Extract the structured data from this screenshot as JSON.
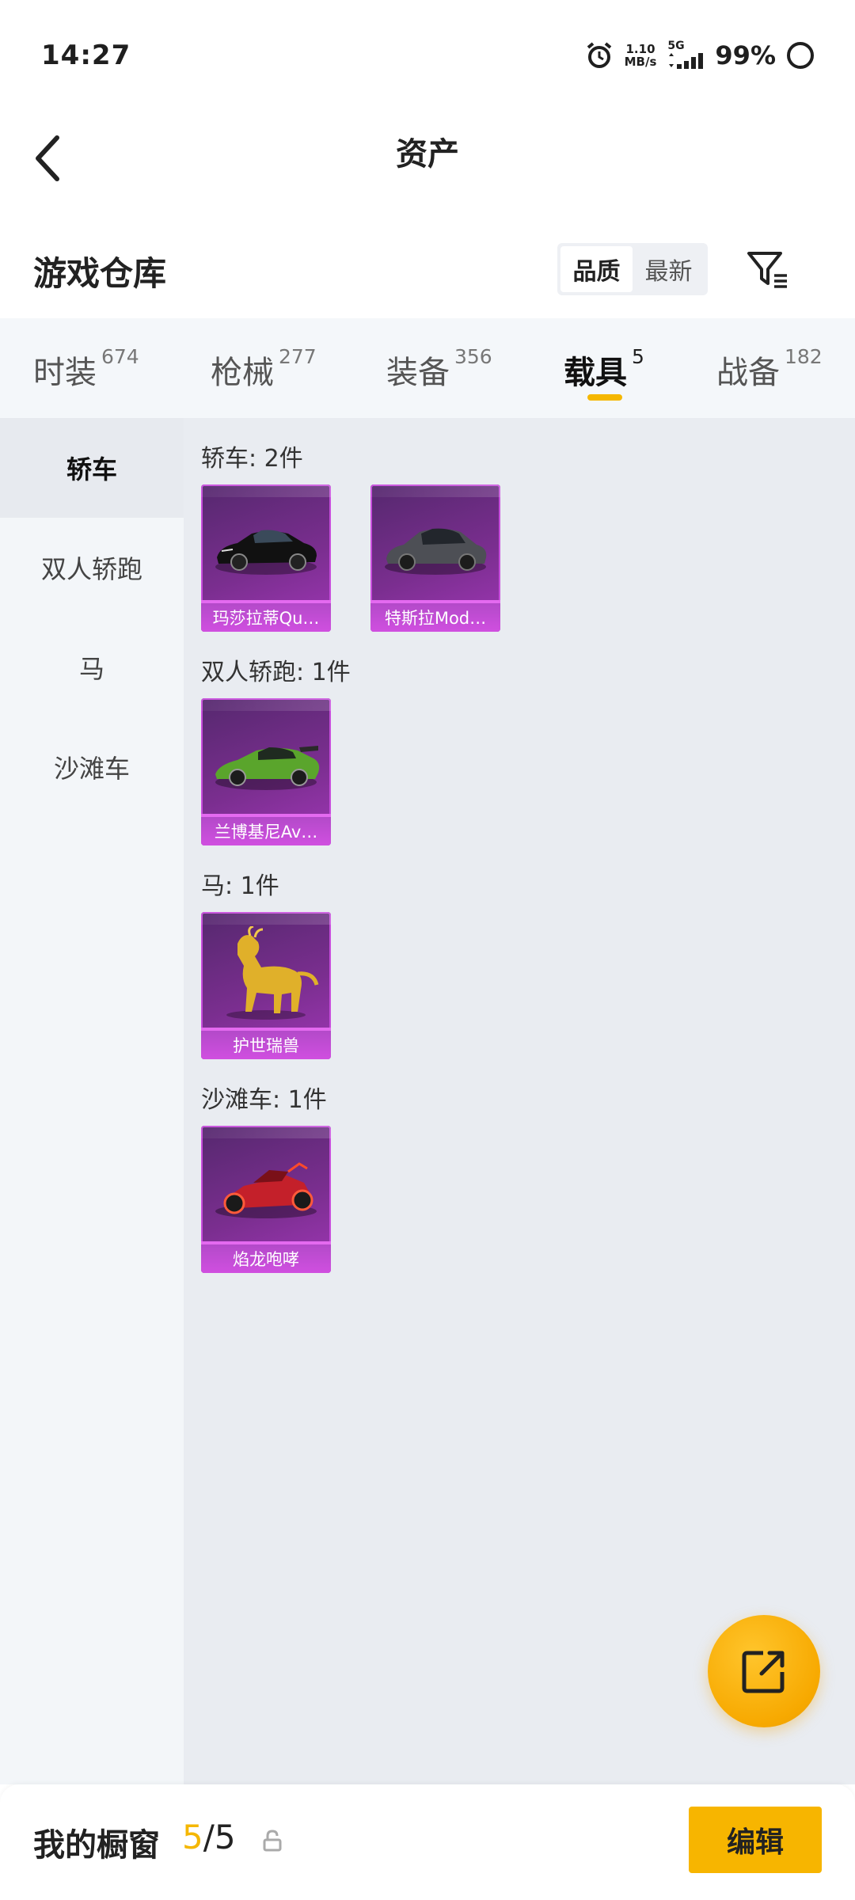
{
  "status_bar": {
    "time": "14:27",
    "net_speed_value": "1.10",
    "net_speed_unit": "MB/s",
    "network_type": "5G",
    "battery": "99%"
  },
  "header": {
    "title": "资产"
  },
  "warehouse": {
    "title": "游戏仓库",
    "sort_options": [
      "品质",
      "最新"
    ],
    "selected_sort": "品质"
  },
  "tabs": [
    {
      "label": "时装",
      "count": "674",
      "active": false
    },
    {
      "label": "枪械",
      "count": "277",
      "active": false
    },
    {
      "label": "装备",
      "count": "356",
      "active": false
    },
    {
      "label": "载具",
      "count": "5",
      "active": true
    },
    {
      "label": "战备",
      "count": "182",
      "active": false
    }
  ],
  "side_categories": [
    {
      "label": "轿车",
      "active": true
    },
    {
      "label": "双人轿跑",
      "active": false
    },
    {
      "label": "马",
      "active": false
    },
    {
      "label": "沙滩车",
      "active": false
    }
  ],
  "groups": [
    {
      "heading": "轿车: 2件",
      "items": [
        {
          "name": "玛莎拉蒂Qu…",
          "icon": "black-sports-car"
        },
        {
          "name": "特斯拉Mod…",
          "icon": "gray-sedan-car"
        }
      ]
    },
    {
      "heading": "双人轿跑: 1件",
      "items": [
        {
          "name": "兰博基尼Av…",
          "icon": "green-supercar"
        }
      ]
    },
    {
      "heading": "马: 1件",
      "items": [
        {
          "name": "护世瑞兽",
          "icon": "golden-qilin"
        }
      ]
    },
    {
      "heading": "沙滩车: 1件",
      "items": [
        {
          "name": "焰龙咆哮",
          "icon": "red-buggy"
        }
      ]
    }
  ],
  "bottom_bar": {
    "label": "我的橱窗",
    "current": "5",
    "separator": "/",
    "total": "5",
    "edit_label": "编辑"
  },
  "colors": {
    "accent": "#f5b700",
    "card_purple": "#7a2e8f",
    "card_band": "#c74ddc"
  }
}
